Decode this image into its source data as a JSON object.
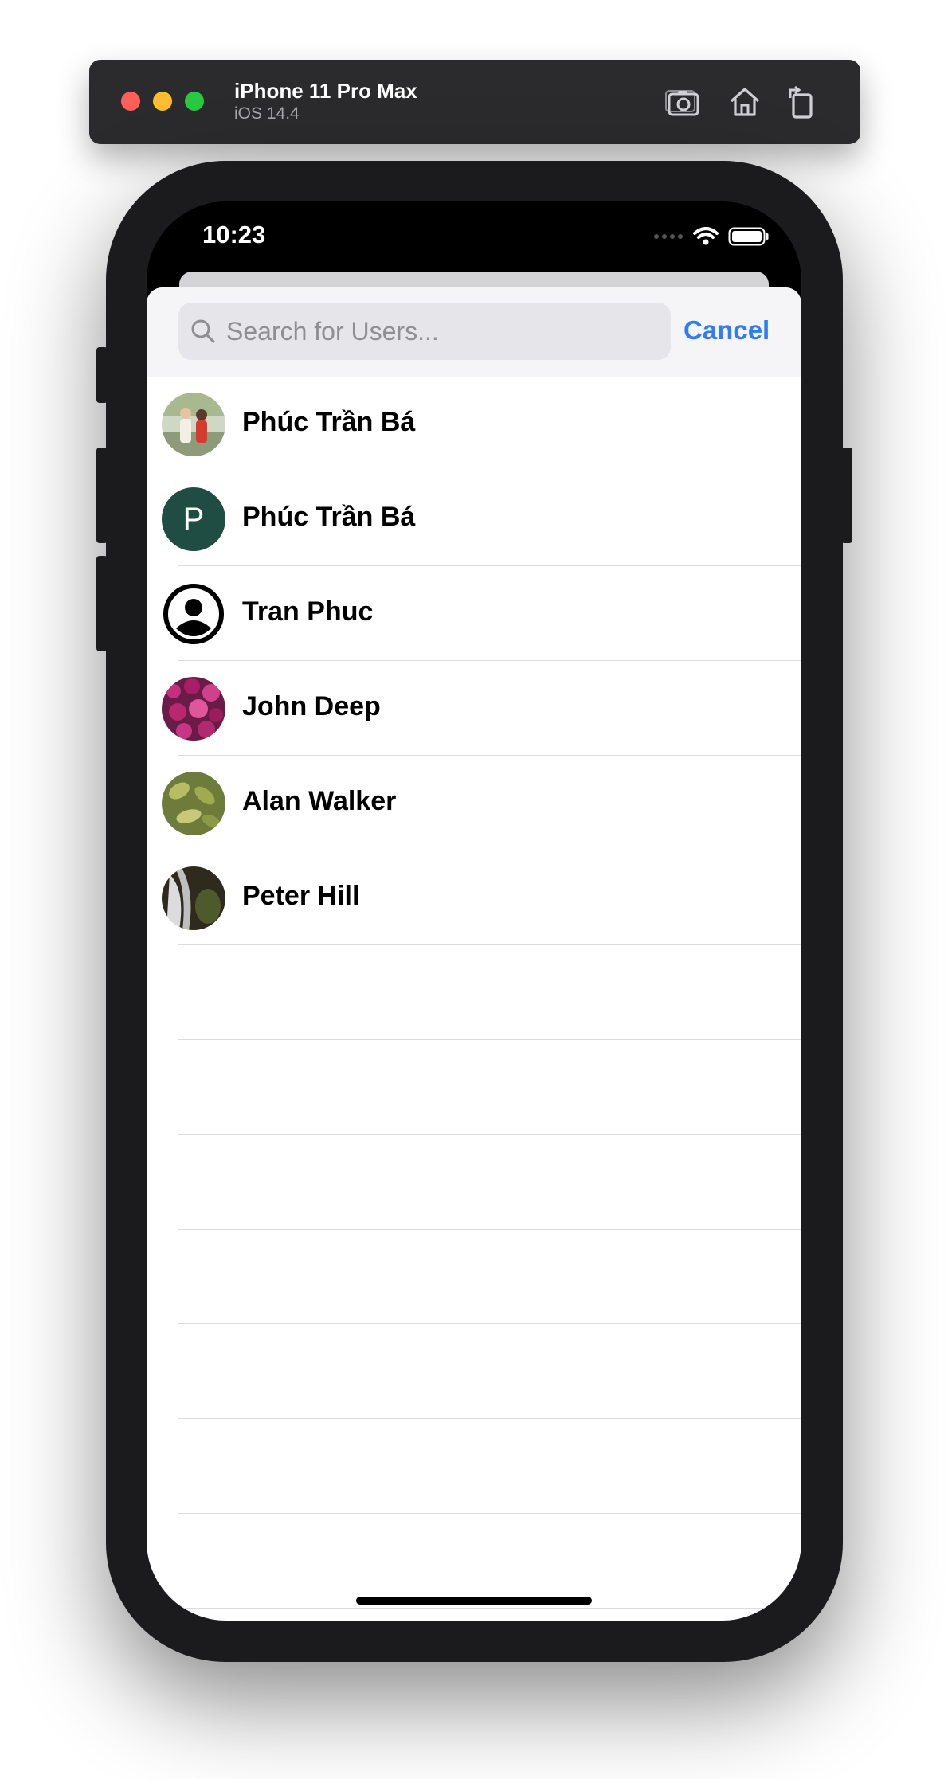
{
  "simulator": {
    "device_name": "iPhone 11 Pro Max",
    "os_version": "iOS 14.4",
    "tools": [
      "screenshot-icon",
      "home-icon",
      "rotate-icon"
    ]
  },
  "status_bar": {
    "time": "10:23"
  },
  "search": {
    "placeholder": "Search for Users...",
    "value": "",
    "cancel_label": "Cancel"
  },
  "users": [
    {
      "name": "Phúc Trần Bá",
      "avatar": "photo"
    },
    {
      "name": "Phúc Trần Bá",
      "avatar": "initial",
      "initial": "P",
      "color": "#1f4d44"
    },
    {
      "name": "Tran Phuc",
      "avatar": "default-person-icon"
    },
    {
      "name": "John Deep",
      "avatar": "photo"
    },
    {
      "name": "Alan Walker",
      "avatar": "photo"
    },
    {
      "name": "Peter Hill",
      "avatar": "photo"
    }
  ],
  "colors": {
    "accent": "#2f7cf6",
    "initial_avatar": "#1f4d44"
  }
}
